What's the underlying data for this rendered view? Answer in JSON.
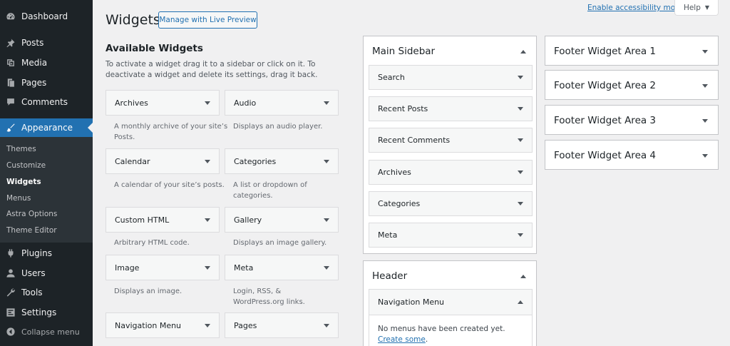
{
  "sidebar": {
    "items": [
      {
        "label": "Dashboard",
        "icon": "dashboard-icon"
      },
      {
        "label": "Posts",
        "icon": "pin-icon"
      },
      {
        "label": "Media",
        "icon": "media-icon"
      },
      {
        "label": "Pages",
        "icon": "pages-icon"
      },
      {
        "label": "Comments",
        "icon": "comment-icon"
      },
      {
        "label": "Appearance",
        "icon": "paintbrush-icon"
      },
      {
        "label": "Plugins",
        "icon": "plugin-icon"
      },
      {
        "label": "Users",
        "icon": "users-icon"
      },
      {
        "label": "Tools",
        "icon": "wrench-icon"
      },
      {
        "label": "Settings",
        "icon": "settings-icon"
      }
    ],
    "submenu": [
      "Themes",
      "Customize",
      "Widgets",
      "Menus",
      "Astra Options",
      "Theme Editor"
    ],
    "collapse_label": "Collapse menu"
  },
  "header": {
    "title": "Widgets",
    "live_preview_button": "Manage with Live Preview",
    "accessibility_link": "Enable accessibility mode",
    "help_label": "Help"
  },
  "available": {
    "title": "Available Widgets",
    "intro": "To activate a widget drag it to a sidebar or click on it. To deactivate a widget and delete its settings, drag it back.",
    "widgets": [
      {
        "name": "Archives",
        "desc": "A monthly archive of your site’s Posts."
      },
      {
        "name": "Audio",
        "desc": "Displays an audio player."
      },
      {
        "name": "Calendar",
        "desc": "A calendar of your site’s posts."
      },
      {
        "name": "Categories",
        "desc": "A list or dropdown of categories."
      },
      {
        "name": "Custom HTML",
        "desc": "Arbitrary HTML code."
      },
      {
        "name": "Gallery",
        "desc": "Displays an image gallery."
      },
      {
        "name": "Image",
        "desc": "Displays an image."
      },
      {
        "name": "Meta",
        "desc": "Login, RSS, & WordPress.org links."
      },
      {
        "name": "Navigation Menu",
        "desc": ""
      },
      {
        "name": "Pages",
        "desc": ""
      }
    ]
  },
  "main_sidebar": {
    "title": "Main Sidebar",
    "widgets": [
      "Search",
      "Recent Posts",
      "Recent Comments",
      "Archives",
      "Categories",
      "Meta"
    ]
  },
  "header_area": {
    "title": "Header",
    "open_widget": "Navigation Menu",
    "message_prefix": "No menus have been created yet.",
    "message_link": "Create some",
    "message_suffix": "."
  },
  "footer_areas": [
    "Footer Widget Area 1",
    "Footer Widget Area 2",
    "Footer Widget Area 3",
    "Footer Widget Area 4"
  ],
  "colors": {
    "accent": "#2271b1",
    "menu_bg": "#1d2327",
    "page_bg": "#f0f0f1"
  }
}
